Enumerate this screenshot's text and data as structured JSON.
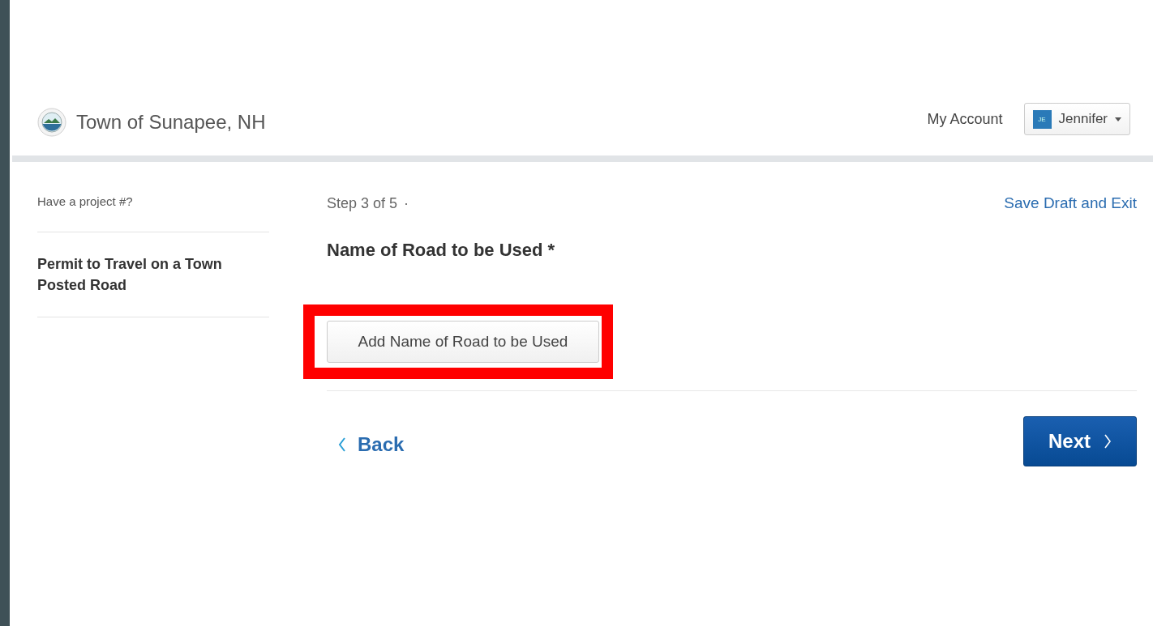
{
  "header": {
    "site_name": "Town of Sunapee, NH",
    "account_link": "My Account",
    "user": {
      "initials": "JE",
      "name": "Jennifer"
    }
  },
  "sidebar": {
    "project_prompt": "Have a project #?",
    "permit_title": "Permit to Travel on a Town Posted Road"
  },
  "form": {
    "step": "Step 3 of 5",
    "step_separator": "·",
    "save_link": "Save Draft and Exit",
    "field_label": "Name of Road to be Used *",
    "add_button": {
      "label": "Add Name of Road to be Used",
      "highlighted": true
    },
    "back_button": "Back",
    "next_button": "Next"
  }
}
